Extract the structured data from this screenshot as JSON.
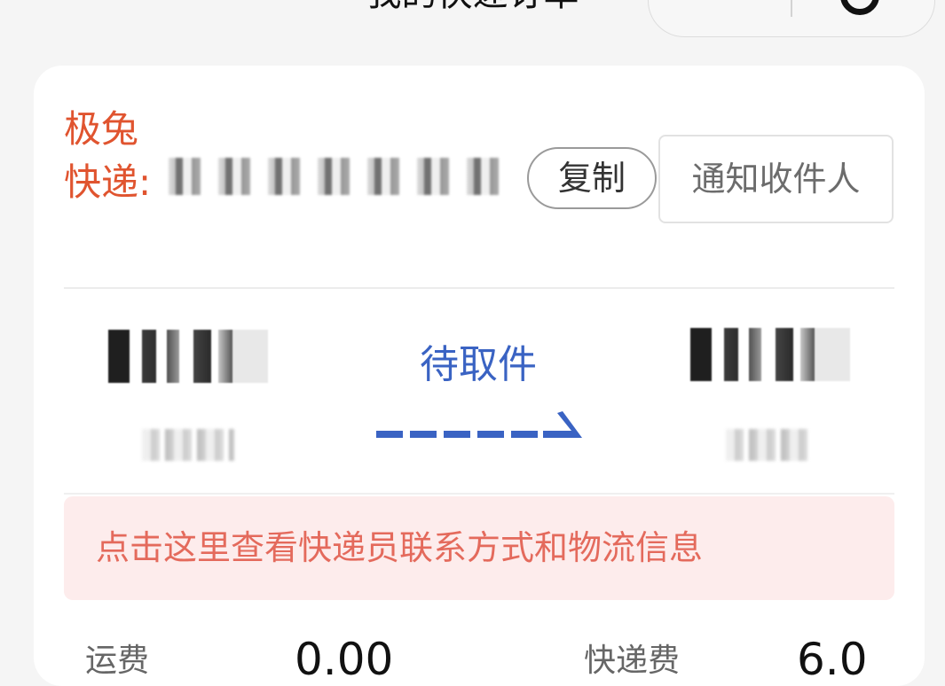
{
  "header": {
    "title": "我的快递订单"
  },
  "order": {
    "carrier_label": "极兔快递:",
    "copy_label": "复制",
    "notify_label": "通知收件人",
    "status": "待取件",
    "info_banner": "点击这里查看快递员联系方式和物流信息"
  },
  "fees": {
    "left_label": "运费",
    "left_value": "0.00",
    "right_label": "快递费",
    "right_value": "6.0"
  },
  "colors": {
    "carrier": "#e0542f",
    "status": "#3a63c3",
    "banner_bg": "#fdecec",
    "banner_text": "#e46a5c"
  }
}
